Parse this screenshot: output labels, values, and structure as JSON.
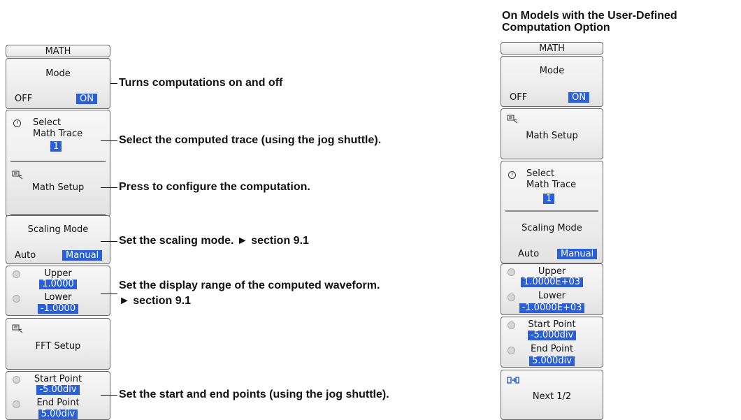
{
  "left_menu": {
    "header": "MATH",
    "mode": {
      "label": "Mode",
      "off": "OFF",
      "on": "ON"
    },
    "select_trace": {
      "label1": "Select",
      "label2": "Math Trace",
      "value": "1"
    },
    "math_setup": {
      "label": "Math Setup"
    },
    "scaling": {
      "label": "Scaling Mode",
      "auto": "Auto",
      "manual": "Manual"
    },
    "range": {
      "upper_label": "Upper",
      "upper_value": "1.0000",
      "lower_label": "Lower",
      "lower_value": "-1.0000"
    },
    "fft_setup": {
      "label": "FFT Setup"
    },
    "points": {
      "start_label": "Start Point",
      "start_value": "-5.00div",
      "end_label": "End Point",
      "end_value": "5.00div"
    }
  },
  "annotations": {
    "mode": "Turns computations on and off",
    "select": "Select the computed trace (using the jog shuttle).",
    "setup": "Press to configure the computation.",
    "scaling": "Set the scaling mode. ► section 9.1",
    "range1": "Set the display range of the computed waveform.",
    "range2": "► section 9.1",
    "points": "Set the start and end points (using the jog shuttle)."
  },
  "right_title": {
    "line1": "On Models with the User-Defined",
    "line2": "Computation Option"
  },
  "right_menu": {
    "header": "MATH",
    "mode": {
      "label": "Mode",
      "off": "OFF",
      "on": "ON"
    },
    "math_setup": {
      "label": "Math Setup"
    },
    "select_trace": {
      "label1": "Select",
      "label2": "Math Trace",
      "value": "1"
    },
    "scaling": {
      "label": "Scaling Mode",
      "auto": "Auto",
      "manual": "Manual"
    },
    "range": {
      "upper_label": "Upper",
      "upper_value": "1.0000E+03",
      "lower_label": "Lower",
      "lower_value": "-1.0000E+03"
    },
    "points": {
      "start_label": "Start Point",
      "start_value": "-5.000div",
      "end_label": "End Point",
      "end_value": "5.000div"
    },
    "next": {
      "label": "Next 1/2"
    }
  },
  "colors": {
    "highlight": "#2b5fd8",
    "panel_border": "#666666"
  },
  "icons": {
    "setup": "setup-menu-icon",
    "jog": "jog-knob-icon",
    "next": "next-page-icon"
  }
}
